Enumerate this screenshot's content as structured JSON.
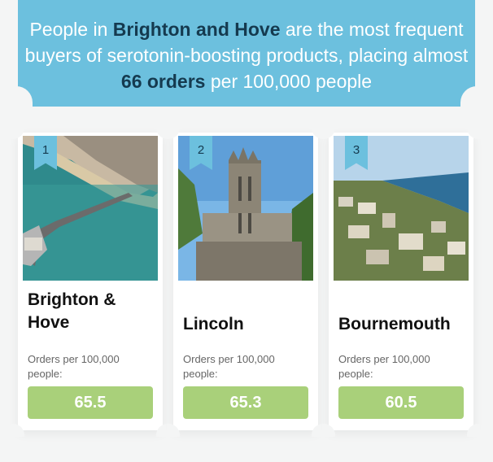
{
  "headline": {
    "part1": "People in ",
    "highlight1": "Brighton and Hove",
    "part2": " are the most frequent buyers of serotonin-boosting products, placing almost ",
    "highlight2": "66 orders",
    "part3": " per 100,000 people"
  },
  "colors": {
    "banner": "#6cc0de",
    "highlight_text": "#153a4f",
    "value_pill": "#a9d07a"
  },
  "cards": [
    {
      "rank": "1",
      "city": "Brighton & Hove",
      "orders_label": "Orders per 100,000 people:",
      "value": "65.5",
      "image": "brighton-pier-aerial-photo"
    },
    {
      "rank": "2",
      "city": "Lincoln",
      "orders_label": "Orders per 100,000 people:",
      "value": "65.3",
      "image": "lincoln-cathedral-photo"
    },
    {
      "rank": "3",
      "city": "Bournemouth",
      "orders_label": "Orders per 100,000 people:",
      "value": "60.5",
      "image": "bournemouth-coast-aerial-photo"
    }
  ]
}
